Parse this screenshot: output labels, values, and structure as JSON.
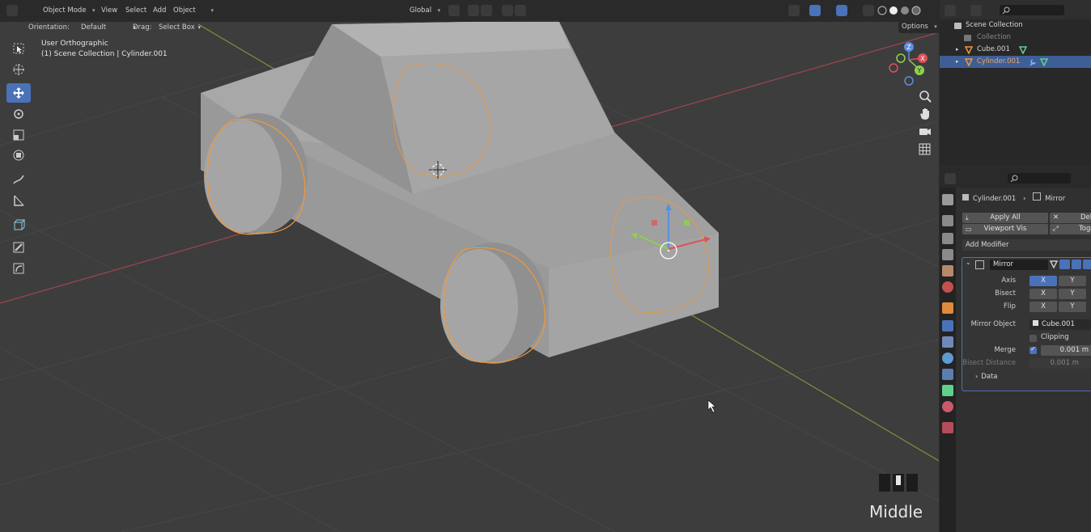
{
  "header": {
    "mode": "Object Mode",
    "menus": [
      "View",
      "Select",
      "Add",
      "Object"
    ],
    "transform_orientation": "Global",
    "options_label": "Options"
  },
  "tool_settings": {
    "orientation_label": "Orientation:",
    "orientation_value": "Default",
    "drag_label": "Drag:",
    "drag_value": "Select Box"
  },
  "viewport_info": {
    "view_name": "User Orthographic",
    "context": "(1) Scene Collection | Cylinder.001"
  },
  "gizmo_axes": [
    "Z",
    "Y",
    "X"
  ],
  "outliner": {
    "scene_collection": "Scene Collection",
    "collection": "Collection",
    "items": [
      {
        "name": "Cube.001",
        "selected": false
      },
      {
        "name": "Cylinder.001",
        "selected": true
      }
    ]
  },
  "properties": {
    "breadcrumb_object": "Cylinder.001",
    "breadcrumb_modifier": "Mirror",
    "apply_all": "Apply All",
    "delete_label": "Del",
    "viewport_vis": "Viewport Vis",
    "toggle_label": "Toggl",
    "add_modifier": "Add Modifier",
    "modifier_name": "Mirror",
    "axis_label": "Axis",
    "bisect_label": "Bisect",
    "flip_label": "Flip",
    "x": "X",
    "y": "Y",
    "mirror_object_label": "Mirror Object",
    "mirror_object_value": "Cube.001",
    "clipping_label": "Clipping",
    "merge_label": "Merge",
    "merge_value": "0.001 m",
    "bisect_distance_label": "Bisect Distance",
    "bisect_distance_value": "0.001 m",
    "data_label": "Data"
  },
  "key_overlay": {
    "label": "Middle"
  },
  "colors": {
    "accent": "#4a72b8",
    "selection_outline": "#f0983c",
    "viewport_bg": "#3d3d3d",
    "panel_bg": "#303030"
  }
}
